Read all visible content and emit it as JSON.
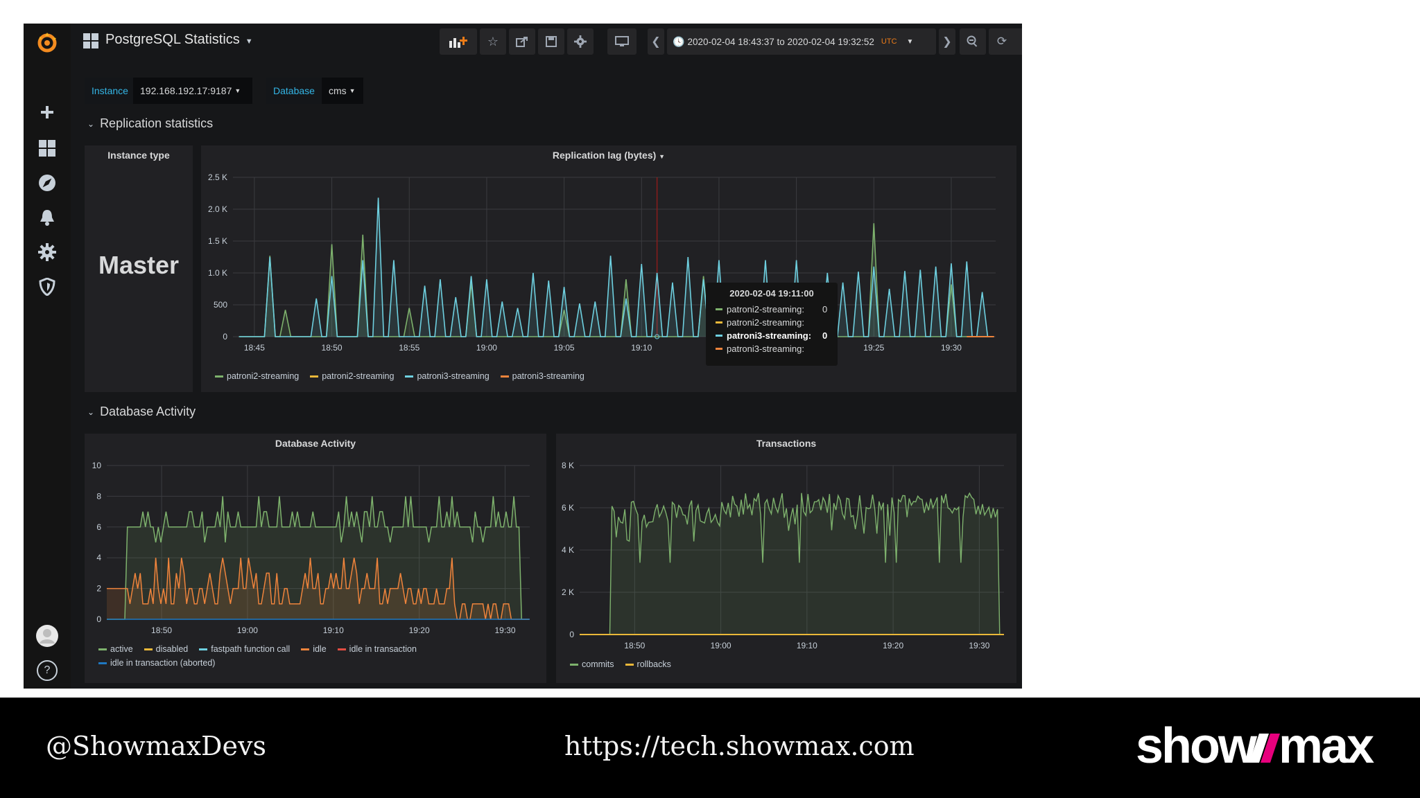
{
  "colors": {
    "green": "#7eb26d",
    "yellow": "#eab839",
    "cyan": "#6ed0e0",
    "orange": "#ef843c",
    "red": "#e24d42",
    "blue": "#1f78c1",
    "accent": "#33b5e5"
  },
  "sidebar": {
    "items": [
      {
        "icon": "plus-icon"
      },
      {
        "icon": "dashboards-icon"
      },
      {
        "icon": "explore-icon"
      },
      {
        "icon": "alerting-bell-icon"
      },
      {
        "icon": "configuration-gear-icon"
      },
      {
        "icon": "server-admin-shield-icon"
      }
    ],
    "bottom": [
      {
        "icon": "user-avatar"
      },
      {
        "icon": "help-icon",
        "label": "?"
      }
    ]
  },
  "header": {
    "title": "PostgreSQL Statistics",
    "time_range": "2020-02-04 18:43:37 to 2020-02-04 19:32:52",
    "timezone": "UTC"
  },
  "variables": {
    "instance_label": "Instance",
    "instance_value": "192.168.192.17:9187",
    "database_label": "Database",
    "database_value": "cms"
  },
  "rows": {
    "replication": "Replication statistics",
    "activity": "Database Activity"
  },
  "instance_panel": {
    "title": "Instance type",
    "value": "Master"
  },
  "tooltip": {
    "time": "2020-02-04 19:11:00",
    "rows": [
      {
        "name": "patroni2-streaming:",
        "value": "0",
        "color": "#7eb26d"
      },
      {
        "name": "patroni2-streaming:",
        "value": "",
        "color": "#eab839"
      },
      {
        "name": "patroni3-streaming:",
        "value": "0",
        "color": "#6ed0e0",
        "bold": true
      },
      {
        "name": "patroni3-streaming:",
        "value": "",
        "color": "#ef843c"
      }
    ]
  },
  "footer": {
    "handle": "@ShowmaxDevs",
    "url": "https://tech.showmax.com",
    "logo": "showmax"
  },
  "chart_data": [
    {
      "type": "line",
      "title": "Replication lag (bytes)",
      "x_ticks": [
        "18:45",
        "18:50",
        "18:55",
        "19:00",
        "19:05",
        "19:10",
        "19:15",
        "19:20",
        "19:25",
        "19:30"
      ],
      "x_tick_labels_shown": [
        "18:45",
        "18:50",
        "18:55",
        "19:00",
        "19:05",
        "19:10",
        "",
        "",
        "19:25",
        "19:30"
      ],
      "x_range": [
        "18:43:37",
        "19:32:52"
      ],
      "y_ticks": [
        {
          "v": 0,
          "l": "0"
        },
        {
          "v": 500,
          "l": "500"
        },
        {
          "v": 1000,
          "l": "1.0 K"
        },
        {
          "v": 1500,
          "l": "1.5 K"
        },
        {
          "v": 2000,
          "l": "2.0 K"
        },
        {
          "v": 2500,
          "l": "2.5 K"
        }
      ],
      "ylim": [
        0,
        2500
      ],
      "series": [
        {
          "name": "patroni2-streaming",
          "color": "#7eb26d",
          "peaks": [
            [
              "18:46",
              1270
            ],
            [
              "18:47",
              420
            ],
            [
              "18:50",
              1450
            ],
            [
              "18:52",
              1600
            ],
            [
              "18:55",
              450
            ],
            [
              "18:59",
              850
            ],
            [
              "19:05",
              420
            ],
            [
              "19:09",
              900
            ],
            [
              "19:14",
              950
            ],
            [
              "19:25",
              1780
            ],
            [
              "19:30",
              820
            ]
          ]
        },
        {
          "name": "patroni2-streaming",
          "color": "#eab839",
          "peaks": []
        },
        {
          "name": "patroni3-streaming",
          "color": "#6ed0e0",
          "peaks": [
            [
              "18:46",
              1250
            ],
            [
              "18:49",
              600
            ],
            [
              "18:50",
              950
            ],
            [
              "18:52",
              1200
            ],
            [
              "18:53",
              2180
            ],
            [
              "18:54",
              1200
            ],
            [
              "18:56",
              800
            ],
            [
              "18:57",
              900
            ],
            [
              "18:58",
              620
            ],
            [
              "18:59",
              950
            ],
            [
              "19:00",
              900
            ],
            [
              "19:01",
              550
            ],
            [
              "19:02",
              450
            ],
            [
              "19:03",
              1000
            ],
            [
              "19:04",
              880
            ],
            [
              "19:05",
              780
            ],
            [
              "19:06",
              520
            ],
            [
              "19:07",
              550
            ],
            [
              "19:08",
              1270
            ],
            [
              "19:09",
              600
            ],
            [
              "19:10",
              1140
            ],
            [
              "19:11",
              1000
            ],
            [
              "19:12",
              850
            ],
            [
              "19:13",
              1250
            ],
            [
              "19:14",
              900
            ],
            [
              "19:15",
              1200
            ],
            [
              "19:16",
              560
            ],
            [
              "19:18",
              1200
            ],
            [
              "19:20",
              1200
            ],
            [
              "19:22",
              1000
            ],
            [
              "19:23",
              850
            ],
            [
              "19:24",
              1020
            ],
            [
              "19:25",
              1100
            ],
            [
              "19:26",
              750
            ],
            [
              "19:27",
              1030
            ],
            [
              "19:28",
              1050
            ],
            [
              "19:29",
              1100
            ],
            [
              "19:30",
              1150
            ],
            [
              "19:31",
              1180
            ],
            [
              "19:32",
              700
            ]
          ]
        },
        {
          "name": "patroni3-streaming",
          "color": "#ef843c",
          "peaks": []
        }
      ]
    },
    {
      "type": "area",
      "title": "Database Activity",
      "x_ticks": [
        "18:50",
        "19:00",
        "19:10",
        "19:20",
        "19:30"
      ],
      "x_range": [
        "18:43:37",
        "19:32:52"
      ],
      "y_ticks": [
        {
          "v": 0,
          "l": "0"
        },
        {
          "v": 2,
          "l": "2"
        },
        {
          "v": 4,
          "l": "4"
        },
        {
          "v": 6,
          "l": "6"
        },
        {
          "v": 8,
          "l": "8"
        },
        {
          "v": 10,
          "l": "10"
        }
      ],
      "ylim": [
        0,
        10
      ],
      "series": [
        {
          "name": "active",
          "color": "#7eb26d",
          "pattern": "mostly 6 with spikes to 7-8 and dips to 5 from 18:46 to 19:32; 0 before 18:46"
        },
        {
          "name": "disabled",
          "color": "#eab839"
        },
        {
          "name": "fastpath function call",
          "color": "#6ed0e0"
        },
        {
          "name": "idle",
          "color": "#ef843c",
          "pattern": "2 from 18:44 to 18:46, then oscillates between 1 and 3 with peaks of 4, falls to 0-1 after 19:24"
        },
        {
          "name": "idle in transaction",
          "color": "#e24d42"
        },
        {
          "name": "idle in transaction (aborted)",
          "color": "#1f78c1"
        }
      ]
    },
    {
      "type": "area",
      "title": "Transactions",
      "x_ticks": [
        "18:50",
        "19:00",
        "19:10",
        "19:20",
        "19:30"
      ],
      "x_range": [
        "18:43:37",
        "19:32:52"
      ],
      "y_ticks": [
        {
          "v": 0,
          "l": "0"
        },
        {
          "v": 2000,
          "l": "2 K"
        },
        {
          "v": 4000,
          "l": "4 K"
        },
        {
          "v": 6000,
          "l": "6 K"
        },
        {
          "v": 8000,
          "l": "8 K"
        }
      ],
      "ylim": [
        0,
        8000
      ],
      "series": [
        {
          "name": "commits",
          "color": "#7eb26d",
          "pattern": "0 until 18:47, then fluctuates between ~4500 and ~6500 until 19:32, then 0"
        },
        {
          "name": "rollbacks",
          "color": "#eab839",
          "pattern": "0 throughout"
        }
      ]
    }
  ]
}
